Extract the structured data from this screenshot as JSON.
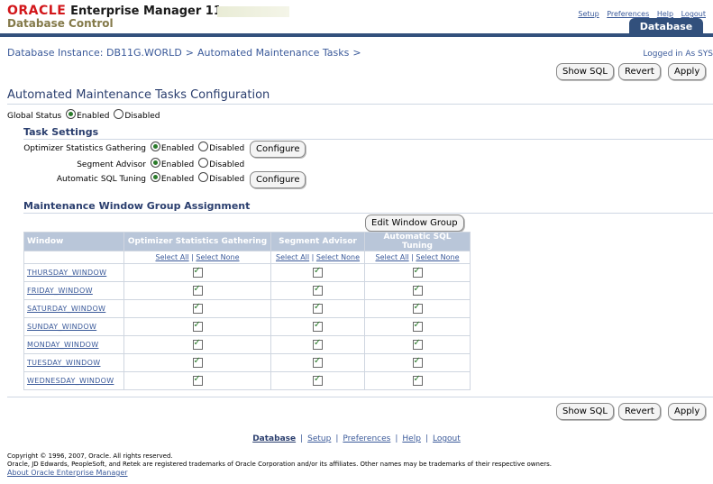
{
  "header": {
    "brand_oracle": "ORACLE",
    "brand_product": "Enterprise Manager 11g",
    "brand_sub": "Database Control",
    "links": [
      "Setup",
      "Preferences",
      "Help",
      "Logout"
    ],
    "tab": "Database"
  },
  "breadcrumb": {
    "items": [
      "Database Instance: DB11G.WORLD",
      "Automated Maintenance Tasks"
    ],
    "separator": ">",
    "logged_in": "Logged in As SYS"
  },
  "actions": {
    "show_sql": "Show SQL",
    "revert": "Revert",
    "apply": "Apply"
  },
  "page_title": "Automated Maintenance Tasks Configuration",
  "global_status": {
    "label": "Global Status",
    "enabled": "Enabled",
    "disabled": "Disabled"
  },
  "task_settings": {
    "heading": "Task Settings",
    "rows": [
      {
        "label": "Optimizer Statistics Gathering",
        "enabled": "Enabled",
        "disabled": "Disabled",
        "configure": "Configure"
      },
      {
        "label": "Segment Advisor",
        "enabled": "Enabled",
        "disabled": "Disabled"
      },
      {
        "label": "Automatic SQL Tuning",
        "enabled": "Enabled",
        "disabled": "Disabled",
        "configure": "Configure"
      }
    ]
  },
  "window_group": {
    "heading": "Maintenance Window Group Assignment",
    "edit_button": "Edit Window Group",
    "columns": [
      "Window",
      "Optimizer Statistics Gathering",
      "Segment Advisor",
      "Automatic SQL Tuning"
    ],
    "select_all": "Select All",
    "select_none": "Select None",
    "windows": [
      "THURSDAY_WINDOW",
      "FRIDAY_WINDOW",
      "SATURDAY_WINDOW",
      "SUNDAY_WINDOW",
      "MONDAY_WINDOW",
      "TUESDAY_WINDOW",
      "WEDNESDAY_WINDOW"
    ]
  },
  "footer": {
    "links": [
      "Database",
      "Setup",
      "Preferences",
      "Help",
      "Logout"
    ],
    "copyright": "Copyright © 1996, 2007, Oracle. All rights reserved.",
    "trademark": "Oracle, JD Edwards, PeopleSoft, and Retek are registered trademarks of Oracle Corporation and/or its affiliates. Other names may be trademarks of their respective owners.",
    "about": "About Oracle Enterprise Manager"
  },
  "colors": {
    "brand_red": "#d2161a",
    "header_blue": "#32507c",
    "link_blue": "#3b5a9a",
    "table_header": "#b9c6d9"
  }
}
